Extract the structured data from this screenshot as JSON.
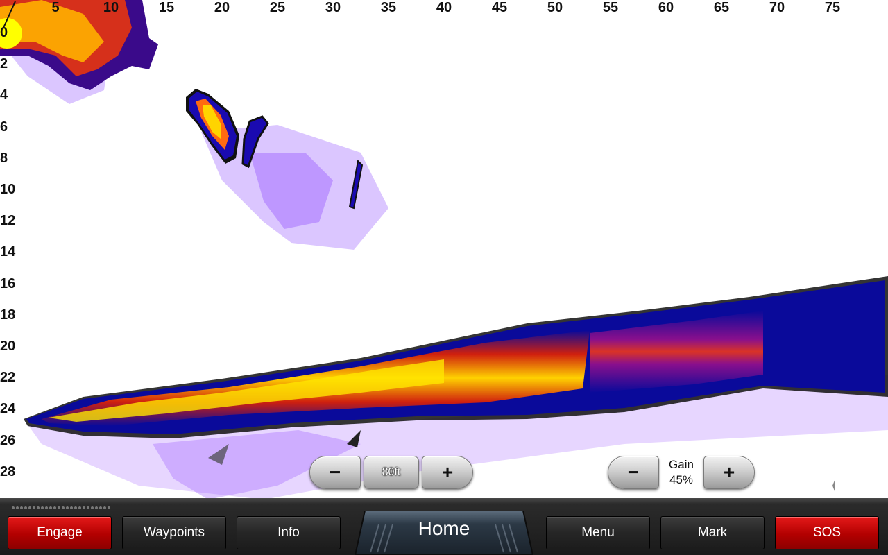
{
  "sonar": {
    "x_ticks": [
      "5",
      "10",
      "15",
      "20",
      "25",
      "30",
      "35",
      "40",
      "45",
      "50",
      "55",
      "60",
      "65",
      "70",
      "75"
    ],
    "y_ticks": [
      "0",
      "2",
      "4",
      "6",
      "8",
      "10",
      "12",
      "14",
      "16",
      "18",
      "20",
      "22",
      "24",
      "26",
      "28"
    ],
    "palette": {
      "yellow": "#ffff00",
      "orange": "#ff8a00",
      "red": "#e8250e",
      "purple": "#5a0a7a",
      "navy": "#0a0a9a",
      "haze": "#b880ff"
    }
  },
  "range_control": {
    "minus_icon": "minus-icon",
    "value": "80ft",
    "plus_icon": "plus-icon"
  },
  "gain_control": {
    "minus_icon": "minus-icon",
    "label": "Gain",
    "value": "45%",
    "plus_icon": "plus-icon"
  },
  "softkeys": {
    "engage": "Engage",
    "waypoints": "Waypoints",
    "info": "Info",
    "home": "Home",
    "menu": "Menu",
    "mark": "Mark",
    "sos": "SOS"
  },
  "colors": {
    "alert_red": "#d01010",
    "bar_dark": "#1f1f1f"
  }
}
